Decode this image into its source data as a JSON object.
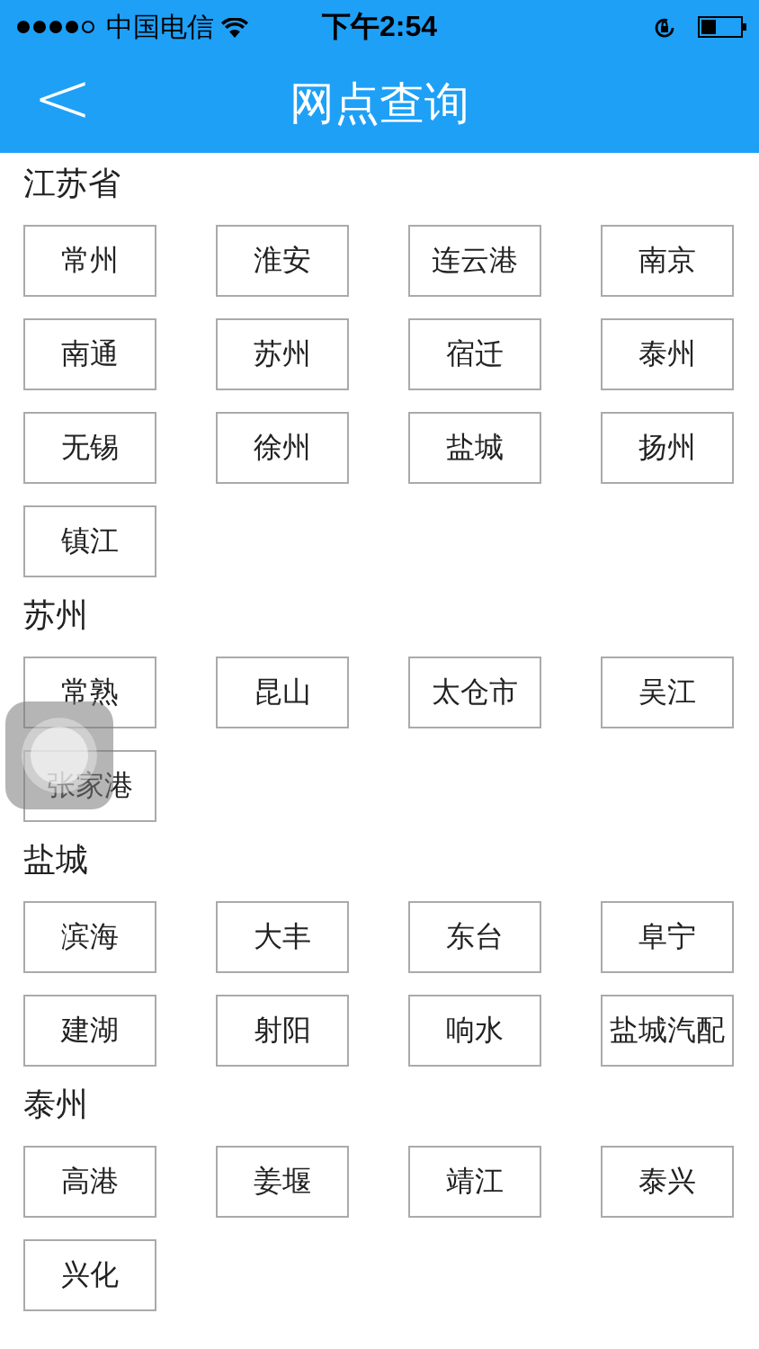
{
  "status_bar": {
    "carrier": "中国电信",
    "time": "下午2:54"
  },
  "nav": {
    "back": "<",
    "title": "网点查询"
  },
  "sections": [
    {
      "title": "江苏省",
      "items": [
        "常州",
        "淮安",
        "连云港",
        "南京",
        "南通",
        "苏州",
        "宿迁",
        "泰州",
        "无锡",
        "徐州",
        "盐城",
        "扬州",
        "镇江"
      ]
    },
    {
      "title": "苏州",
      "items": [
        "常熟",
        "昆山",
        "太仓市",
        "吴江",
        "张家港"
      ]
    },
    {
      "title": "盐城",
      "items": [
        "滨海",
        "大丰",
        "东台",
        "阜宁",
        "建湖",
        "射阳",
        "响水",
        "盐城汽配"
      ]
    },
    {
      "title": "泰州",
      "items": [
        "高港",
        "姜堰",
        "靖江",
        "泰兴",
        "兴化"
      ]
    }
  ]
}
